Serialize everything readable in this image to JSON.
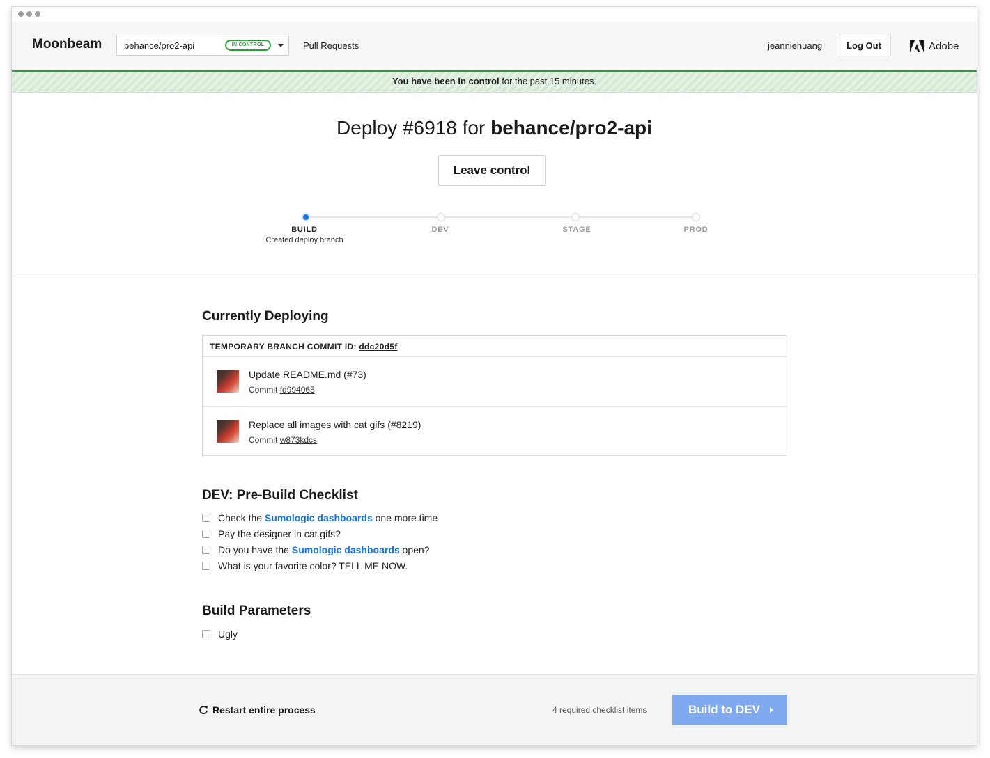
{
  "header": {
    "brand": "Moonbeam",
    "repo": "behance/pro2-api",
    "status_badge": "IN CONTROL",
    "nav_link": "Pull Requests",
    "username": "jeanniehuang",
    "logout_label": "Log Out",
    "company": "Adobe"
  },
  "banner": {
    "bold": "You have been in control",
    "rest": " for the past 15 minutes."
  },
  "deploy": {
    "title_prefix": "Deploy #6918 for ",
    "title_repo": "behance/pro2-api",
    "leave_label": "Leave control"
  },
  "stages": [
    {
      "label": "BUILD",
      "sub": "Created deploy branch",
      "active": true
    },
    {
      "label": "DEV",
      "sub": "",
      "active": false
    },
    {
      "label": "STAGE",
      "sub": "",
      "active": false
    },
    {
      "label": "PROD",
      "sub": "",
      "active": false
    }
  ],
  "current": {
    "heading": "Currently Deploying",
    "branch_label": "TEMPORARY BRANCH COMMIT ID:",
    "branch_id": "ddc20d5f",
    "commit_word": "Commit",
    "commits": [
      {
        "title": "Update README.md (#73)",
        "hash": "fd994065"
      },
      {
        "title": "Replace all images with cat gifs (#8219)",
        "hash": "w873kdcs"
      }
    ]
  },
  "checklist": {
    "heading": "DEV: Pre-Build Checklist",
    "items": [
      {
        "before": "Check the ",
        "link": "Sumologic dashboards",
        "after": " one more time"
      },
      {
        "before": "Pay the designer in cat gifs?",
        "link": "",
        "after": ""
      },
      {
        "before": "Do you have the ",
        "link": "Sumologic dashboards",
        "after": " open?"
      },
      {
        "before": "What is your favorite color? TELL ME NOW.",
        "link": "",
        "after": ""
      }
    ]
  },
  "params": {
    "heading": "Build Parameters",
    "items": [
      {
        "label": "Ugly"
      }
    ]
  },
  "footer": {
    "restart_label": "Restart entire process",
    "required_text": "4 required checklist items",
    "build_label": "Build to DEV"
  },
  "colors": {
    "accent_green": "#21a336",
    "link_blue": "#1473e6",
    "build_button": "#80aaf0"
  },
  "icons": [
    "window-dots-icon",
    "chevron-down-icon",
    "adobe-logo-icon",
    "restart-icon",
    "chevron-right-icon"
  ]
}
